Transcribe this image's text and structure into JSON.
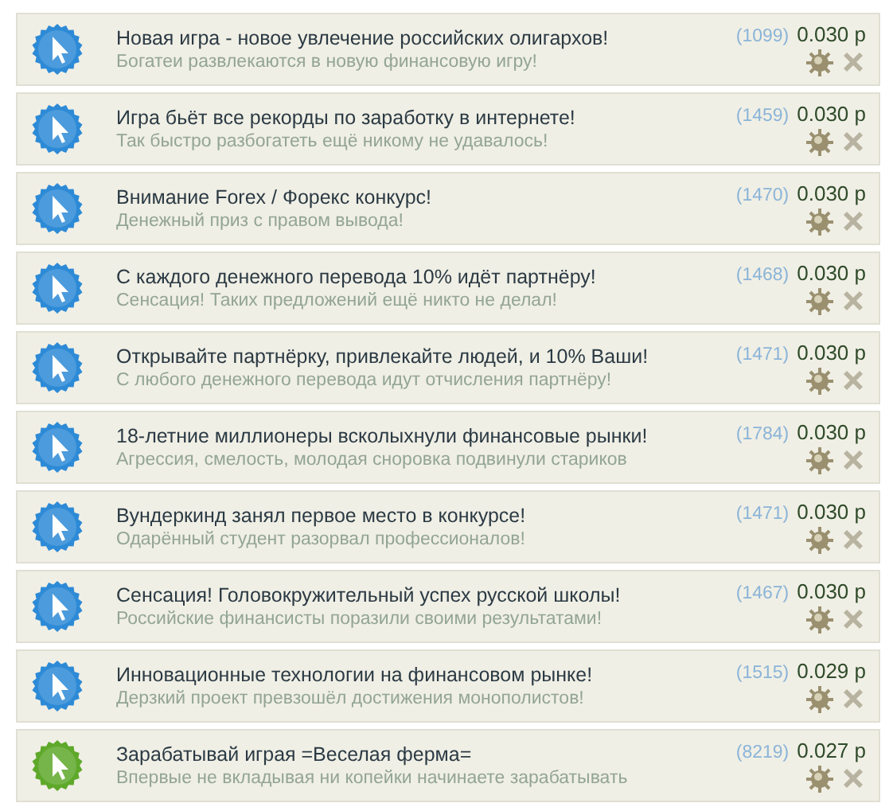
{
  "items": [
    {
      "title": "Новая игра - новое увлечение российских олигархов!",
      "subtitle": "Богатеи развлекаются в новую финансовую игру!",
      "count": "(1099)",
      "price": "0.030 р",
      "color": "#2d8ad6"
    },
    {
      "title": "Игра бьёт все рекорды по заработку в интернете!",
      "subtitle": "Так быстро разбогатеть ещё никому не удавалось!",
      "count": "(1459)",
      "price": "0.030 р",
      "color": "#2d8ad6"
    },
    {
      "title": "Внимание Forex / Форекс конкурс!",
      "subtitle": "Денежный приз с правом вывода!",
      "count": "(1470)",
      "price": "0.030 р",
      "color": "#2d8ad6"
    },
    {
      "title": "С каждого денежного перевода 10% идёт партнёру!",
      "subtitle": "Сенсация! Таких предложений ещё никто не делал!",
      "count": "(1468)",
      "price": "0.030 р",
      "color": "#2d8ad6"
    },
    {
      "title": "Открывайте партнёрку, привлекайте людей, и 10% Ваши!",
      "subtitle": "С любого денежного перевода идут отчисления партнёру!",
      "count": "(1471)",
      "price": "0.030 р",
      "color": "#2d8ad6"
    },
    {
      "title": "18-летние миллионеры всколыхнули финансовые рынки!",
      "subtitle": "Агрессия, смелость, молодая сноровка подвинули стариков",
      "count": "(1784)",
      "price": "0.030 р",
      "color": "#2d8ad6"
    },
    {
      "title": "Вундеркинд занял первое место в конкурсе!",
      "subtitle": "Одарённый студент разорвал профессионалов!",
      "count": "(1471)",
      "price": "0.030 р",
      "color": "#2d8ad6"
    },
    {
      "title": "Сенсация! Головокружительный успех русской школы!",
      "subtitle": "Российские финансисты поразили своими результатами!",
      "count": "(1467)",
      "price": "0.030 р",
      "color": "#2d8ad6"
    },
    {
      "title": "Инновационные технологии на финансовом рынке!",
      "subtitle": "Дерзкий проект превзошёл достижения монополистов!",
      "count": "(1515)",
      "price": "0.029 р",
      "color": "#2d8ad6"
    },
    {
      "title": "Зарабатывай играя =Веселая ферма=",
      "subtitle": "Впервые не вкладывая ни копейки начинаете зарабатывать",
      "count": "(8219)",
      "price": "0.027 р",
      "color": "#5ea82a"
    }
  ]
}
